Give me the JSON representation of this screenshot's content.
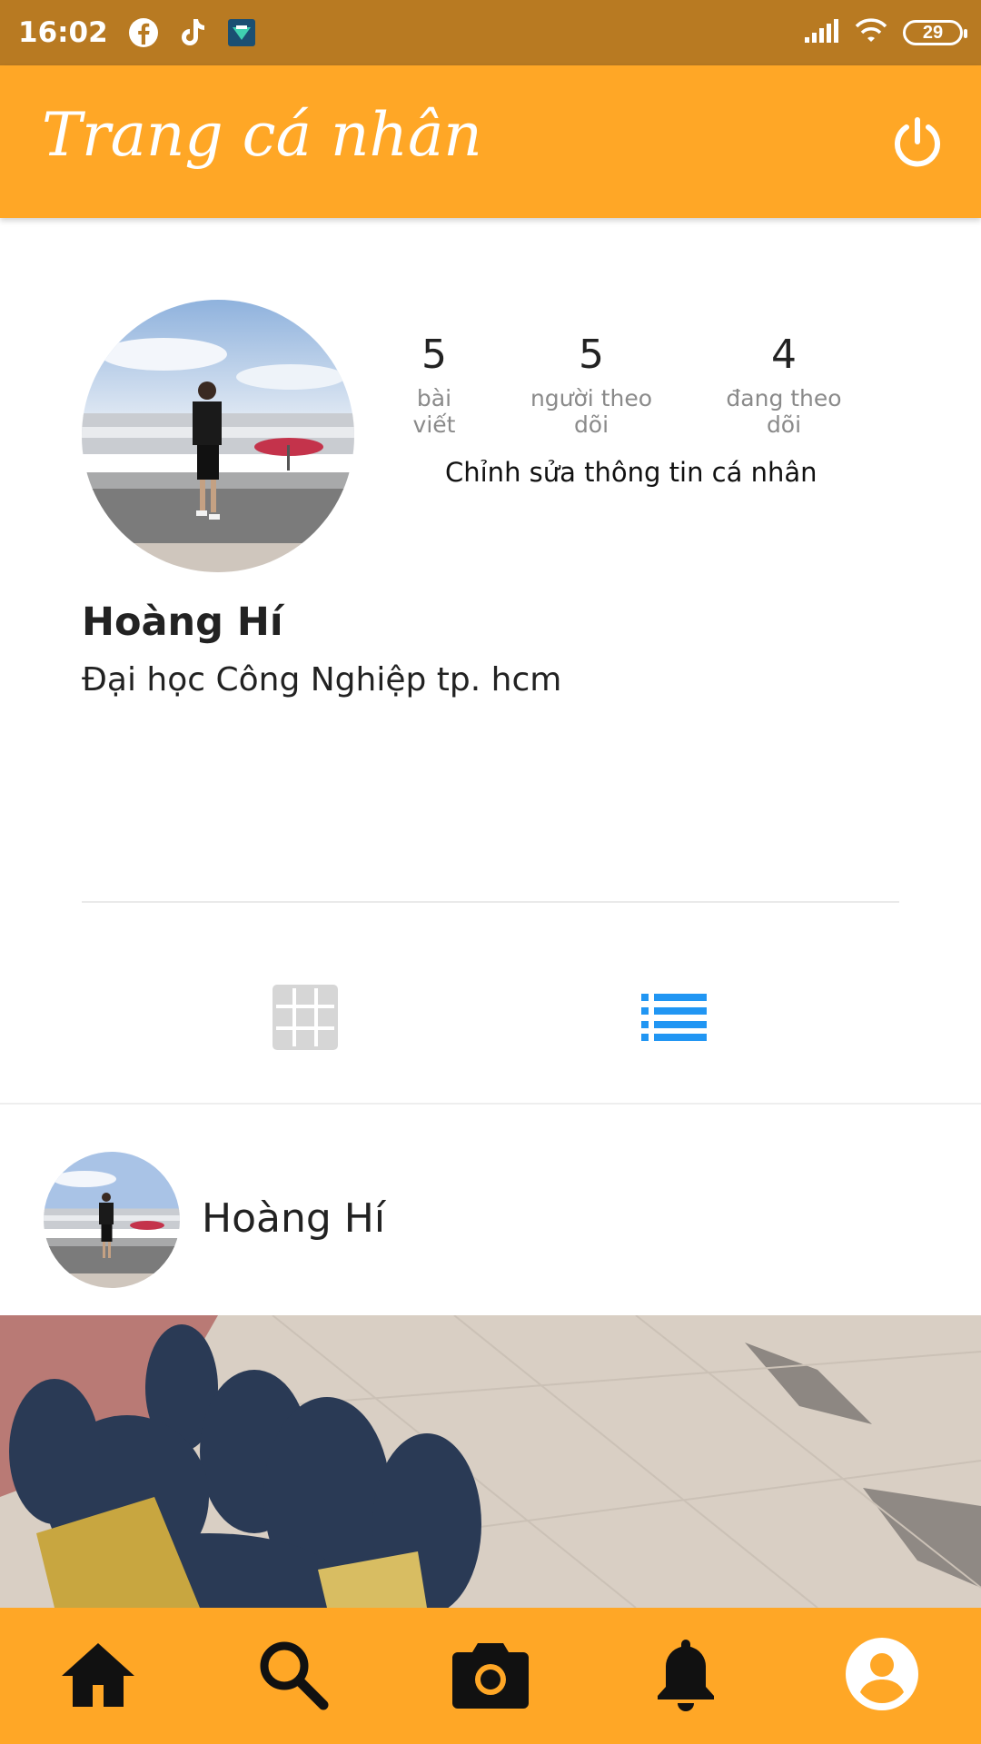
{
  "status_bar": {
    "time": "16:02",
    "app_icons": [
      "facebook-icon",
      "tiktok-icon",
      "app-icon"
    ],
    "battery": "29",
    "signal_icon": "signal-icon",
    "wifi_icon": "wifi-icon"
  },
  "app_bar": {
    "title": "Trang cá nhân",
    "power_icon": "power-icon"
  },
  "profile": {
    "stats": [
      {
        "value": "5",
        "label": "bài viết"
      },
      {
        "value": "5",
        "label": "người theo dõi"
      },
      {
        "value": "4",
        "label": "đang theo dõi"
      }
    ],
    "edit_label": "Chỉnh sửa thông tin cá nhân",
    "name": "Hoàng Hí",
    "bio": "Đại học Công Nghiệp tp. hcm"
  },
  "view_toggle": {
    "grid_icon": "grid-icon",
    "list_icon": "list-icon",
    "active": "list",
    "active_color": "#2196F3",
    "inactive_color": "#d6d6d6"
  },
  "post": {
    "author": "Hoàng Hí"
  },
  "bottom_nav": {
    "items": [
      "home-icon",
      "search-icon",
      "camera-icon",
      "notification-icon",
      "account-icon"
    ]
  },
  "colors": {
    "status_bar": "#B87A22",
    "accent": "#FFA726"
  }
}
